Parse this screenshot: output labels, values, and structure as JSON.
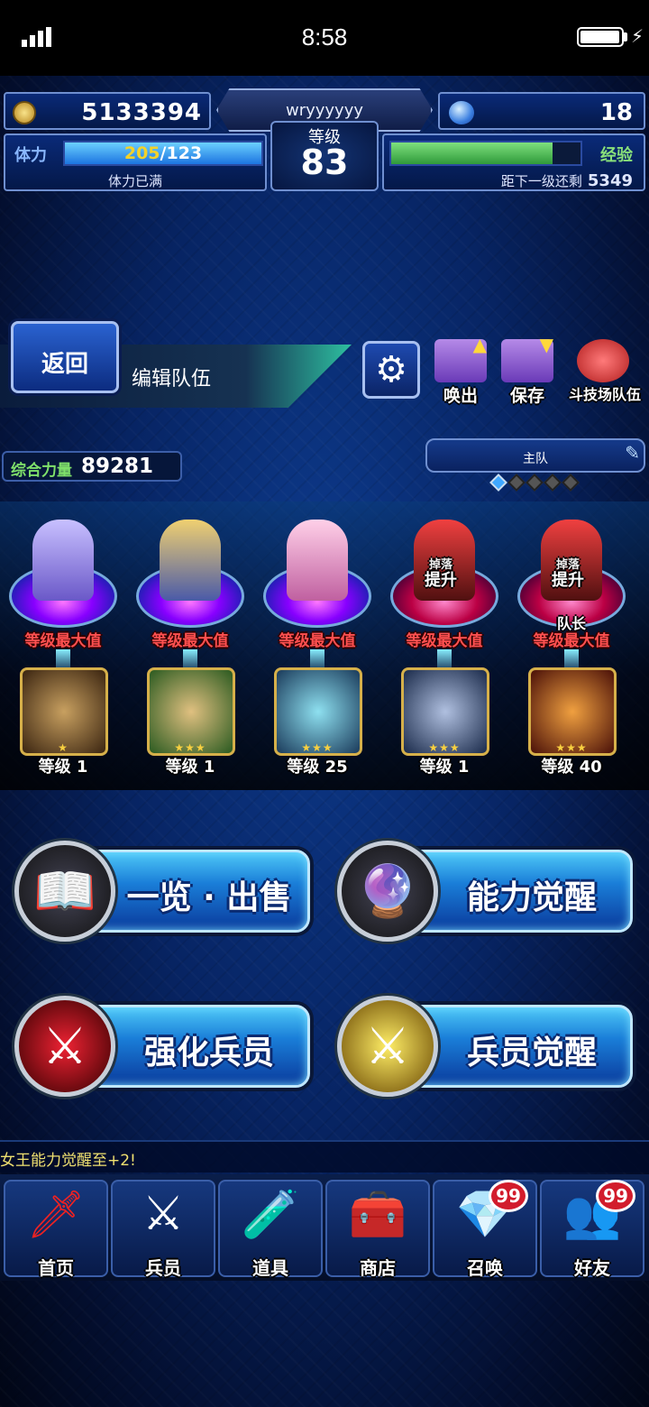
{
  "status": {
    "time": "8:58"
  },
  "hud": {
    "gold": "5133394",
    "player_name": "wryyyyyy",
    "level_label": "等级",
    "level": "83",
    "gems": "18",
    "stamina_label": "体力",
    "stamina_current": "205",
    "stamina_max": "/123",
    "stamina_status": "体力已满",
    "exp_label": "经验",
    "exp_progress": 0.85,
    "exp_remaining_label": "距下一级还剩",
    "exp_remaining": "5349"
  },
  "nav": {
    "back_label": "返回",
    "title": "编辑队伍",
    "summon_out_label": "唤出",
    "save_label": "保存",
    "arena_party_label": "斗技场队伍"
  },
  "party": {
    "power_label": "综合力量",
    "power_value": "89281",
    "party_name": "主队",
    "page_index": 1,
    "page_count": 5
  },
  "units": [
    {
      "max_label": "等级最大值",
      "esper_stars": "★",
      "esper_level_label": "等级",
      "esper_level": "1"
    },
    {
      "max_label": "等级最大值",
      "esper_stars": "★★★",
      "esper_level_label": "等级",
      "esper_level": "1"
    },
    {
      "max_label": "等级最大值",
      "esper_stars": "★★★",
      "esper_level_label": "等级",
      "esper_level": "25"
    },
    {
      "max_label": "等级最大值",
      "boost_top": "掉落",
      "boost_label": "提升",
      "esper_stars": "★★★",
      "esper_level_label": "等级",
      "esper_level": "1"
    },
    {
      "max_label": "等级最大值",
      "boost_top": "掉落",
      "boost_label": "提升",
      "leader_label": "队长",
      "esper_stars": "★★★",
      "esper_level_label": "等级",
      "esper_level": "40"
    }
  ],
  "menu": {
    "list_sell": "一览 · 出售",
    "ability_awaken": "能力觉醒",
    "enhance_units": "强化兵员",
    "unit_awaken": "兵员觉醒"
  },
  "ticker": "女王能力觉醒至+2!",
  "bottom_nav": [
    {
      "label": "首页",
      "icon": "sword-icon"
    },
    {
      "label": "兵员",
      "icon": "knight-icon"
    },
    {
      "label": "道具",
      "icon": "potion-icon"
    },
    {
      "label": "商店",
      "icon": "chest-icon"
    },
    {
      "label": "召唤",
      "icon": "crystal-icon",
      "badge": "99"
    },
    {
      "label": "好友",
      "icon": "friends-icon",
      "badge": "99"
    }
  ]
}
